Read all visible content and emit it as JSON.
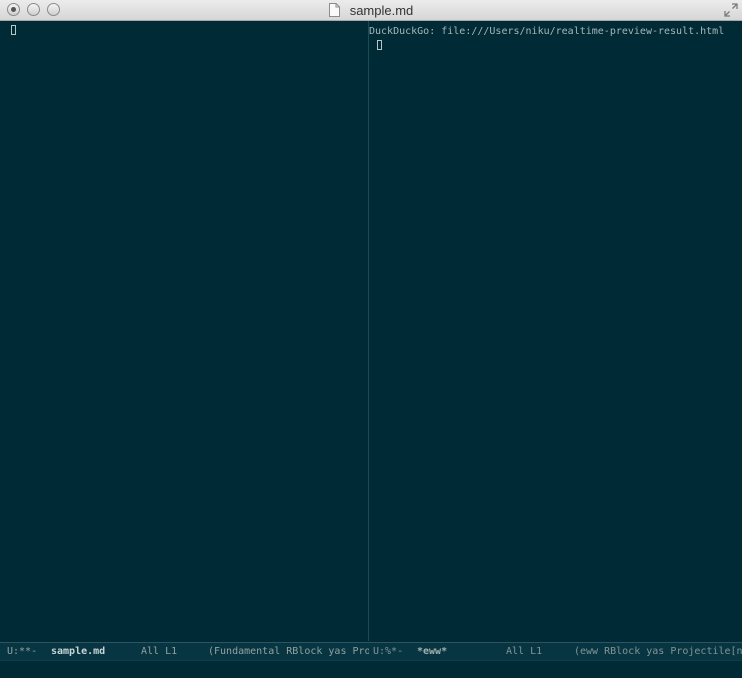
{
  "window": {
    "title": "sample.md"
  },
  "left_pane": {
    "modeline": {
      "status": "U:**-",
      "buffer_name": "sample.md",
      "position": "All L1",
      "modes": "(Fundamental RBlock yas Pro"
    }
  },
  "right_pane": {
    "header": "DuckDuckGo: file:///Users/niku/realtime-preview-result.html",
    "modeline": {
      "status": "U:%*-",
      "buffer_name": "*eww*",
      "position": "All L1",
      "modes": "(eww RBlock yas Projectile[n"
    }
  },
  "colors": {
    "background": "#002b36",
    "modeline_bg": "#073642",
    "text": "#93a1a1"
  }
}
